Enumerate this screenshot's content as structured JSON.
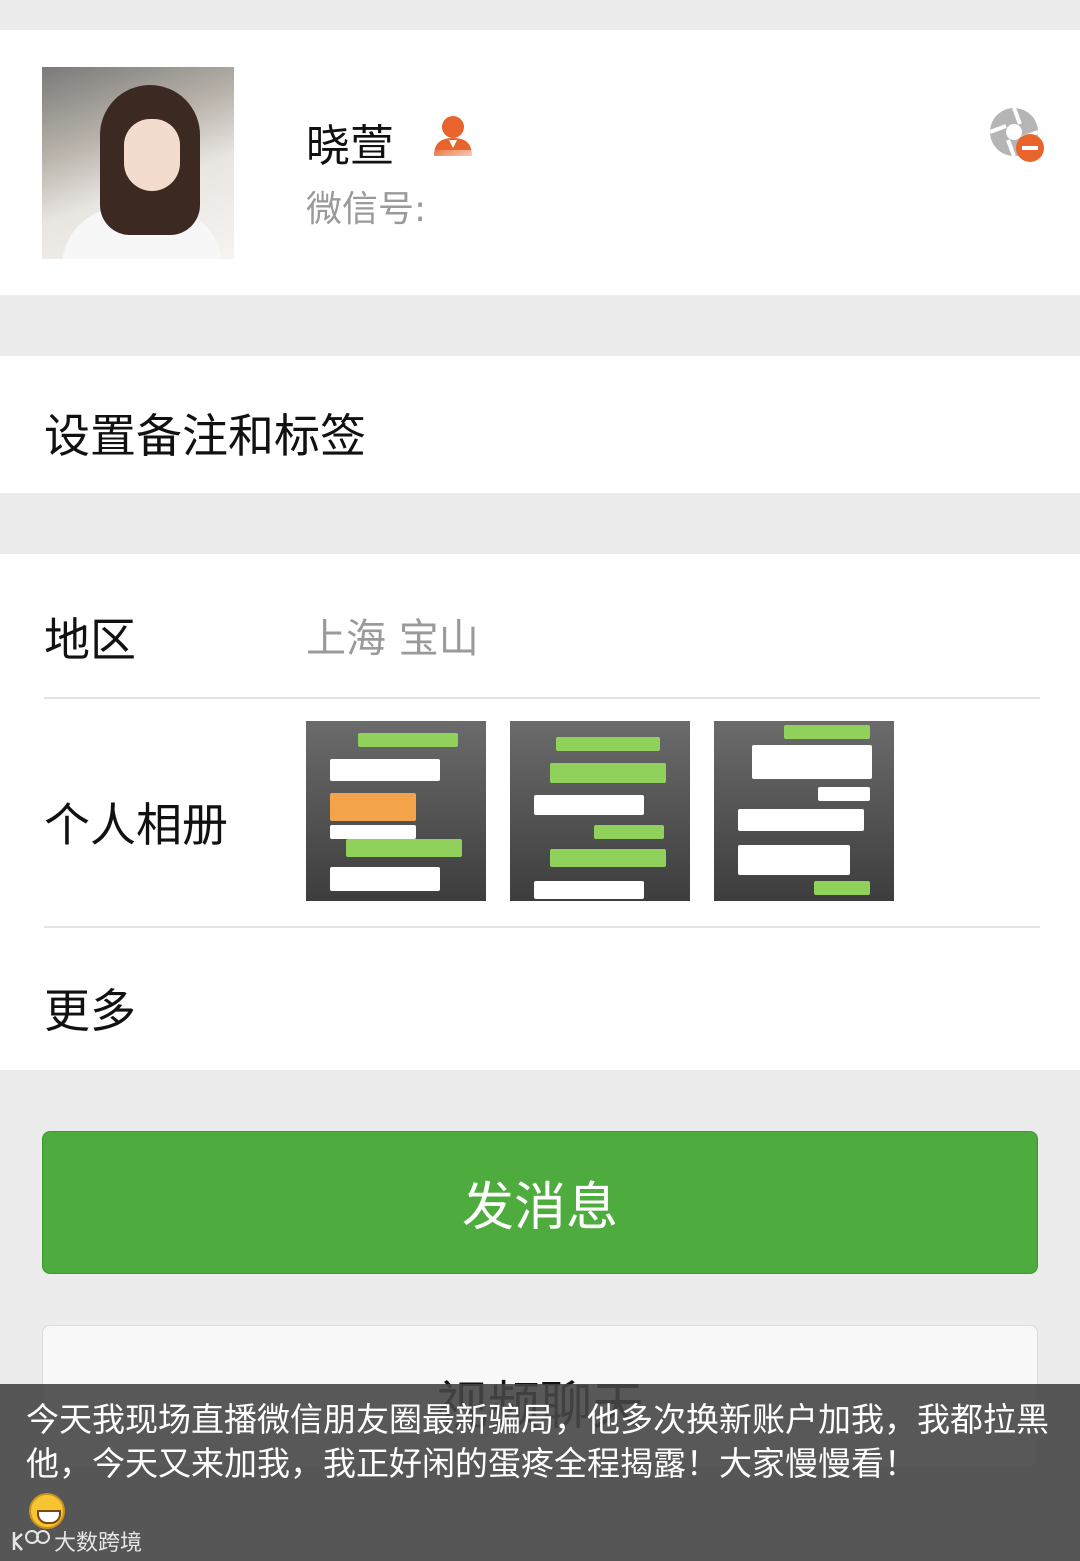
{
  "profile": {
    "name": "晓萱",
    "wechat_id_label": "微信号",
    "icons": {
      "person": "person-icon",
      "moments": "shutter-remove-icon"
    },
    "accent_icon_color": "#e8642c"
  },
  "remark": {
    "label": "设置备注和标签"
  },
  "info": {
    "region_label": "地区",
    "region_value": "上海  宝山",
    "album_label": "个人相册",
    "more_label": "更多"
  },
  "actions": {
    "send_message": "发消息",
    "video_call": "视频聊天",
    "primary_color": "#4eac3e"
  },
  "caption": {
    "text": "今天我现场直播微信朋友圈最新骗局，他多次换新账户加我，我都拉黑他，今天又来加我，我正好闲的蛋疼全程揭露！大家慢慢看！",
    "emoji": "grinning-face-icon"
  },
  "watermark": {
    "text": "大数跨境"
  }
}
